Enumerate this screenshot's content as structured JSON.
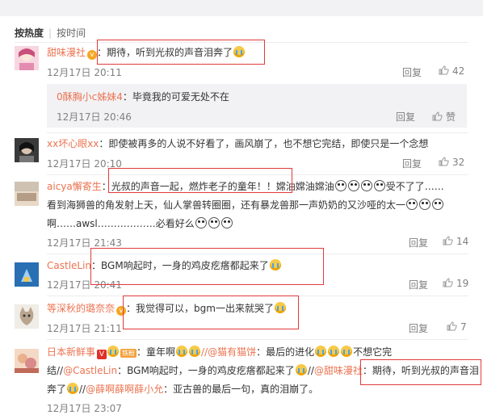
{
  "sort": {
    "hot": "按热度",
    "time": "按时间"
  },
  "actions": {
    "reply": "回复",
    "like": "赞"
  },
  "comments": [
    {
      "name": "甜味漫社",
      "text": "：期待，听到光叔的声音泪奔了",
      "time": "12月17日 20:11",
      "likes": "42"
    },
    {
      "name": "0酥胸小c姊妹4",
      "text": "：毕竟我的可爱无处不在",
      "time": "12月17日 20:46"
    },
    {
      "name": "xx坏心眼xx",
      "text": "：即使被再多的人说不好看了，画风崩了，也不想它完结，即使只是一个念想",
      "time": "12月17日 20:10",
      "likes": "32"
    },
    {
      "name": "aicya懈寄生",
      "text1a": "：光叔的声音一起，燃炸老子的童年！！",
      "text1b": "嫦油嫦油嫦油",
      "text1c": "受不了了……",
      "text2a": "看到海狮兽的角发射上天，仙人掌兽转圈圈，还有暴龙兽那一声奶奶的又沙哑的太一",
      "text3a": "啊……awsl………………必看好么",
      "time": "12月17日 21:43",
      "likes": "14"
    },
    {
      "name": "CastleLin",
      "text": "：BGM响起时，一身的鸡皮疙瘩都起来了",
      "time": "12月17日 20:41",
      "likes": "19"
    },
    {
      "name": "等深秋的璐奈奈",
      "text": "：我觉得可以，bgm一出来就哭了",
      "time": "12月17日 21:11",
      "likes": "7"
    },
    {
      "name": "日本新鲜事",
      "fan": "铁粉",
      "text1a": "：童年啊",
      "at1": "//@猫有猫饼",
      "text1b": "：最后的进化",
      "text1c": "不想它完",
      "text2a": "结//",
      "at2": "@CastleLin",
      "text2b": "：BGM响起时，一身的鸡皮疙瘩都起来了",
      "text2c": "//",
      "at3": "@甜味漫社",
      "text2d": "：期待，听到光叔的声音泪",
      "text3a": "奔了",
      "text3b": "//",
      "at4": "@薛啊薛啊薛小允",
      "text3c": "：亚古兽的最后一句，真的泪崩了。",
      "time": "12月17日 23:07"
    }
  ]
}
